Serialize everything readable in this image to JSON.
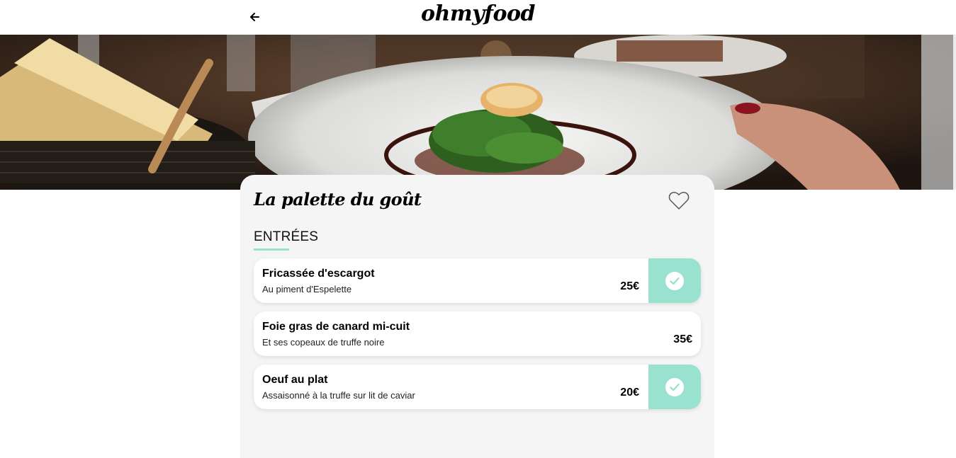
{
  "header": {
    "logo": "ohmyfood",
    "back_icon": "arrow-left-icon"
  },
  "hero": {
    "image_subject": "plated dish on white plate with bread basket"
  },
  "restaurant": {
    "name": "La palette du goût",
    "favorite_icon": "heart-outline-icon"
  },
  "menu": {
    "section_title": "ENTRÉES",
    "items": [
      {
        "name": "Fricassée d'escargot",
        "description": "Au piment d'Espelette",
        "price": "25€",
        "checked": true
      },
      {
        "name": "Foie gras de canard mi-cuit",
        "description": "Et ses copeaux de truffe noire",
        "price": "35€",
        "checked": false
      },
      {
        "name": "Oeuf au plat",
        "description": "Assaisonné à la truffe sur lit de caviar",
        "price": "20€",
        "checked": true
      }
    ]
  },
  "colors": {
    "accent": "#99e2d0",
    "card_bg": "#f5f5f5",
    "text": "#000000"
  }
}
